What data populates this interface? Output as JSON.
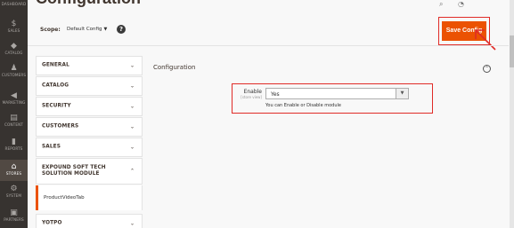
{
  "page": {
    "title": "Configuration"
  },
  "admin_nav": [
    {
      "label": "DASHBOARD",
      "icon": "dashboard-icon",
      "glyph": "▰"
    },
    {
      "label": "SALES",
      "icon": "dollar-icon",
      "glyph": "$"
    },
    {
      "label": "CATALOG",
      "icon": "box-icon",
      "glyph": "◆"
    },
    {
      "label": "CUSTOMERS",
      "icon": "person-icon",
      "glyph": "♟"
    },
    {
      "label": "MARKETING",
      "icon": "megaphone-icon",
      "glyph": "◀"
    },
    {
      "label": "CONTENT",
      "icon": "layout-icon",
      "glyph": "▤"
    },
    {
      "label": "REPORTS",
      "icon": "bar-chart-icon",
      "glyph": "▮"
    },
    {
      "label": "STORES",
      "icon": "store-icon",
      "glyph": "⌂"
    },
    {
      "label": "SYSTEM",
      "icon": "gear-icon",
      "glyph": "⚙"
    },
    {
      "label": "PARTNERS",
      "icon": "puzzle-icon",
      "glyph": "▣"
    }
  ],
  "scope": {
    "label": "Scope:",
    "value": "Default Config",
    "help_icon": "question-icon",
    "help_glyph": "?"
  },
  "toolbar": {
    "save_label": "Save Config"
  },
  "tabs": [
    {
      "label": "GENERAL",
      "expanded": false
    },
    {
      "label": "CATALOG",
      "expanded": false
    },
    {
      "label": "SECURITY",
      "expanded": false
    },
    {
      "label": "CUSTOMERS",
      "expanded": false
    },
    {
      "label": "SALES",
      "expanded": false
    },
    {
      "label": "EXPOUND SOFT TECH SOLUTION MODULE",
      "expanded": true,
      "items": [
        {
          "label": "ProductVideoTab",
          "active": true
        }
      ]
    },
    {
      "label": "YOTPO",
      "expanded": false
    }
  ],
  "section": {
    "title": "Configuration",
    "collapse_icon": "collapse-up-icon"
  },
  "field": {
    "label": "Enable",
    "scope": "[store view]",
    "value": "Yes",
    "note": "You can Enable or Disable module"
  },
  "colors": {
    "accent": "#eb5202",
    "highlight": "#e02b27",
    "nav_bg": "#373330"
  }
}
